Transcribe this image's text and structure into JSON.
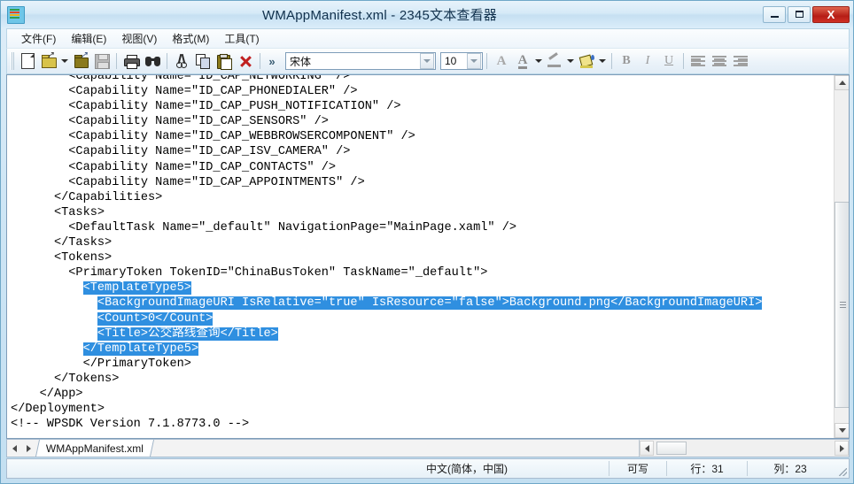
{
  "window": {
    "title": "WMAppManifest.xml - 2345文本查看器",
    "app_icon": "layered-file-icon",
    "controls": {
      "minimize": "minimize-icon",
      "maximize": "maximize-icon",
      "close": "X"
    }
  },
  "menubar": {
    "items": [
      {
        "label": "文件(F)",
        "mnemonic": "F"
      },
      {
        "label": "编辑(E)",
        "mnemonic": "E"
      },
      {
        "label": "视图(V)",
        "mnemonic": "V"
      },
      {
        "label": "格式(M)",
        "mnemonic": "M"
      },
      {
        "label": "工具(T)",
        "mnemonic": "T"
      }
    ]
  },
  "toolbar": {
    "buttons": [
      "new-document-icon",
      "open-file-icon",
      "open-file-dropdown-icon",
      "save-as-icon",
      "save-icon",
      "print-icon",
      "find-icon",
      "cut-icon",
      "copy-icon",
      "paste-icon",
      "delete-icon",
      "overflow-chevron-icon"
    ],
    "overflow_label": "»",
    "font_name": "宋体",
    "font_size": "10",
    "format_buttons": [
      "font-grow-icon",
      "font-color-icon",
      "font-color-dropdown-icon",
      "highlight-pen-icon",
      "highlight-dropdown-icon",
      "fill-bucket-icon",
      "fill-dropdown-icon",
      "bold-icon",
      "italic-icon",
      "underline-icon",
      "align-left-icon",
      "align-center-icon",
      "align-right-icon"
    ],
    "bold_label": "B",
    "italic_label": "I",
    "underline_label": "U"
  },
  "editor": {
    "lines": [
      {
        "text": "        <Capability Name=\"ID_CAP_NETWORKING\" />",
        "clipped_top": true
      },
      {
        "text": "        <Capability Name=\"ID_CAP_PHONEDIALER\" />"
      },
      {
        "text": "        <Capability Name=\"ID_CAP_PUSH_NOTIFICATION\" />"
      },
      {
        "text": "        <Capability Name=\"ID_CAP_SENSORS\" />"
      },
      {
        "text": "        <Capability Name=\"ID_CAP_WEBBROWSERCOMPONENT\" />"
      },
      {
        "text": "        <Capability Name=\"ID_CAP_ISV_CAMERA\" />"
      },
      {
        "text": "        <Capability Name=\"ID_CAP_CONTACTS\" />"
      },
      {
        "text": "        <Capability Name=\"ID_CAP_APPOINTMENTS\" />"
      },
      {
        "text": "      </Capabilities>"
      },
      {
        "text": "      <Tasks>"
      },
      {
        "text": "        <DefaultTask Name=\"_default\" NavigationPage=\"MainPage.xaml\" />"
      },
      {
        "text": "      </Tasks>"
      },
      {
        "text": "      <Tokens>"
      },
      {
        "text": "        <PrimaryToken TokenID=\"ChinaBusToken\" TaskName=\"_default\">"
      },
      {
        "text": "          <TemplateType5>",
        "selected": true,
        "indent": 10
      },
      {
        "text": "            <BackgroundImageURI IsRelative=\"true\" IsResource=\"false\">Background.png</BackgroundImageURI>",
        "selected": true,
        "indent": 12
      },
      {
        "text": "            <Count>0</Count>",
        "selected": true,
        "indent": 12
      },
      {
        "text": "            <Title>公交路线查询</Title>",
        "selected": true,
        "indent": 12
      },
      {
        "text": "          </TemplateType5>",
        "selected": true,
        "indent": 10
      },
      {
        "text": "          </PrimaryToken>"
      },
      {
        "text": "      </Tokens>"
      },
      {
        "text": "    </App>"
      },
      {
        "text": "</Deployment>"
      },
      {
        "text": "<!-- WPSDK Version 7.1.8773.0 -->"
      }
    ],
    "selection_color": "#2f8fe0",
    "selection_text_color": "#ffffff"
  },
  "tabstrip": {
    "prev_icon": "tab-prev-icon",
    "next_icon": "tab-next-icon",
    "tab_label": "WMAppManifest.xml"
  },
  "statusbar": {
    "language": "中文(简体，中国)",
    "writable": "可写",
    "row": "行：31",
    "column": "列：23"
  }
}
